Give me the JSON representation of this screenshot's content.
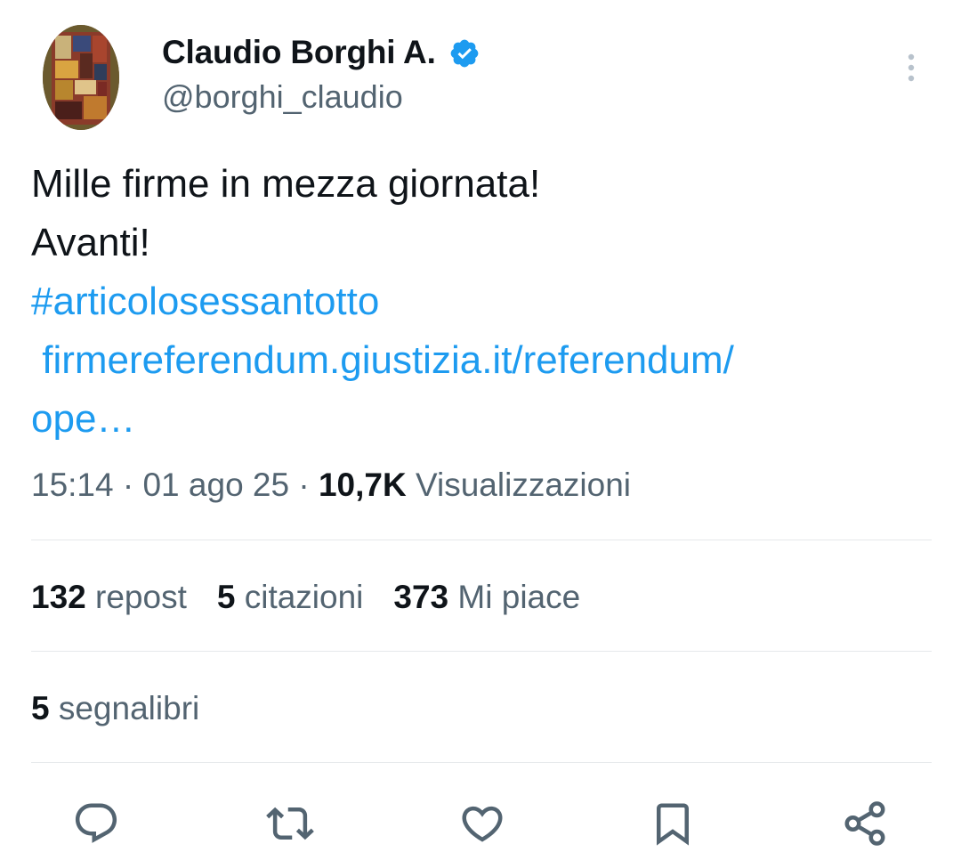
{
  "author": {
    "display_name": "Claudio Borghi A.",
    "handle": "@borghi_claudio",
    "verified": true
  },
  "tweet": {
    "lines": [
      {
        "text": "Mille firme in mezza giornata!",
        "type": "text"
      },
      {
        "text": "Avanti!",
        "type": "text"
      },
      {
        "text": "#articolosessantotto",
        "type": "hashtag"
      },
      {
        "text": " firmereferendum.giustizia.it/referendum/",
        "type": "link"
      },
      {
        "text": "ope…",
        "type": "link"
      }
    ]
  },
  "meta": {
    "time": "15:14",
    "separator": "·",
    "date": "01 ago 25",
    "views_count": "10,7K",
    "views_label": "Visualizzazioni"
  },
  "stats": {
    "reposts_count": "132",
    "reposts_label": "repost",
    "quotes_count": "5",
    "quotes_label": "citazioni",
    "likes_count": "373",
    "likes_label": "Mi piace",
    "bookmarks_count": "5",
    "bookmarks_label": "segnalibri"
  },
  "icons": {
    "verified": "verified-badge-icon",
    "more": "more-vertical-icon",
    "reply": "reply-icon",
    "repost": "repost-icon",
    "like": "heart-icon",
    "bookmark": "bookmark-icon",
    "share": "share-icon"
  },
  "colors": {
    "accent": "#1d9bf0",
    "text": "#0f1419",
    "secondary": "#536471",
    "divider": "#e6e9eb"
  }
}
